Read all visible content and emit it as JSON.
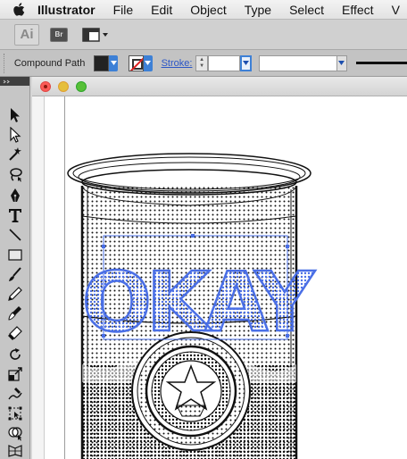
{
  "menubar": {
    "app_name": "Illustrator",
    "items": [
      "File",
      "Edit",
      "Object",
      "Type",
      "Select",
      "Effect",
      "V"
    ]
  },
  "appbar": {
    "logo_text": "Ai",
    "bridge_label": "Br"
  },
  "controlbar": {
    "selection_type": "Compound Path",
    "stroke_label": "Stroke:",
    "stroke_weight": "",
    "fill_color": "#222222"
  },
  "tools": [
    "selection-tool",
    "direct-selection-tool",
    "magic-wand-tool",
    "lasso-tool",
    "pen-tool",
    "type-tool",
    "line-segment-tool",
    "rectangle-tool",
    "paintbrush-tool",
    "pencil-tool",
    "blob-brush-tool",
    "eraser-tool",
    "rotate-tool",
    "scale-tool",
    "warp-tool",
    "free-transform-tool",
    "shape-builder-tool",
    "perspective-grid-tool"
  ],
  "document": {
    "artwork_text": "OKAY",
    "selection_color": "#4a6fe6"
  }
}
